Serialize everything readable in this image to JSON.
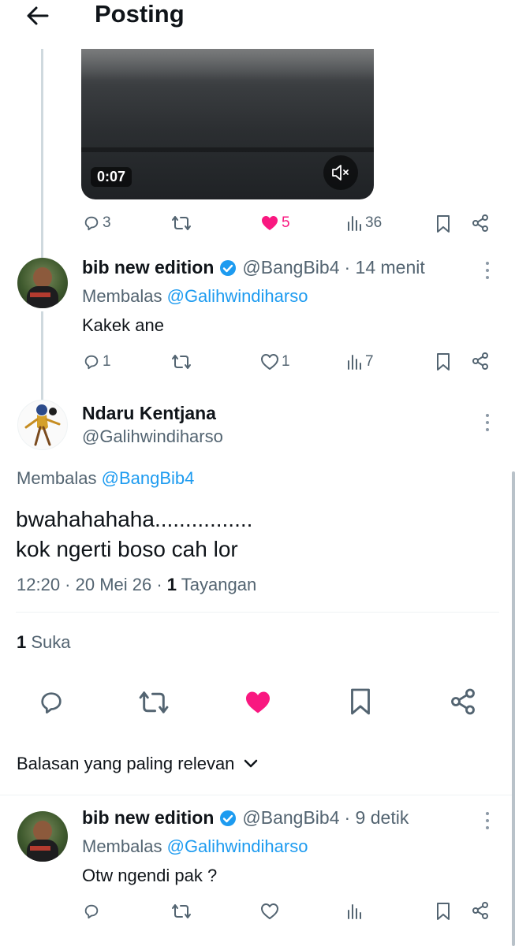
{
  "header": {
    "title": "Posting"
  },
  "video": {
    "duration": "0:07"
  },
  "post_actions": {
    "replies": "3",
    "likes": "5",
    "views": "36"
  },
  "reply1": {
    "name": "bib new edition",
    "handle": "@BangBib4",
    "time": "· 14 menit",
    "replying_prefix": "Membalas",
    "replying_to": "@Galihwindiharso",
    "text": "Kakek ane",
    "replies": "1",
    "likes": "1",
    "views": "7"
  },
  "main": {
    "name": "Ndaru Kentjana",
    "handle": "@Galihwindiharso",
    "replying_prefix": "Membalas",
    "replying_to": "@BangBib4",
    "text_line1": "bwahahahaha................",
    "text_line2": "kok ngerti boso cah lor",
    "timestamp": "12:20 · 20 Mei 26 ·",
    "views_count": "1",
    "views_label": "Tayangan",
    "likes_count": "1",
    "likes_label": "Suka"
  },
  "sort": {
    "label": "Balasan yang paling relevan"
  },
  "reply2": {
    "name": "bib new edition",
    "handle": "@BangBib4",
    "time": "· 9 detik",
    "replying_prefix": "Membalas",
    "replying_to": "@Galihwindiharso",
    "text": "Otw ngendi pak ?"
  },
  "colors": {
    "accent": "#1d9bf0",
    "like": "#f91880",
    "text": "#0f1419",
    "secondary": "#536471"
  },
  "icons": [
    "back-arrow-icon",
    "mute-icon",
    "reply-icon",
    "repost-icon",
    "heart-icon",
    "views-icon",
    "bookmark-icon",
    "share-icon",
    "verified-badge-icon",
    "more-icon",
    "chevron-down-icon"
  ]
}
